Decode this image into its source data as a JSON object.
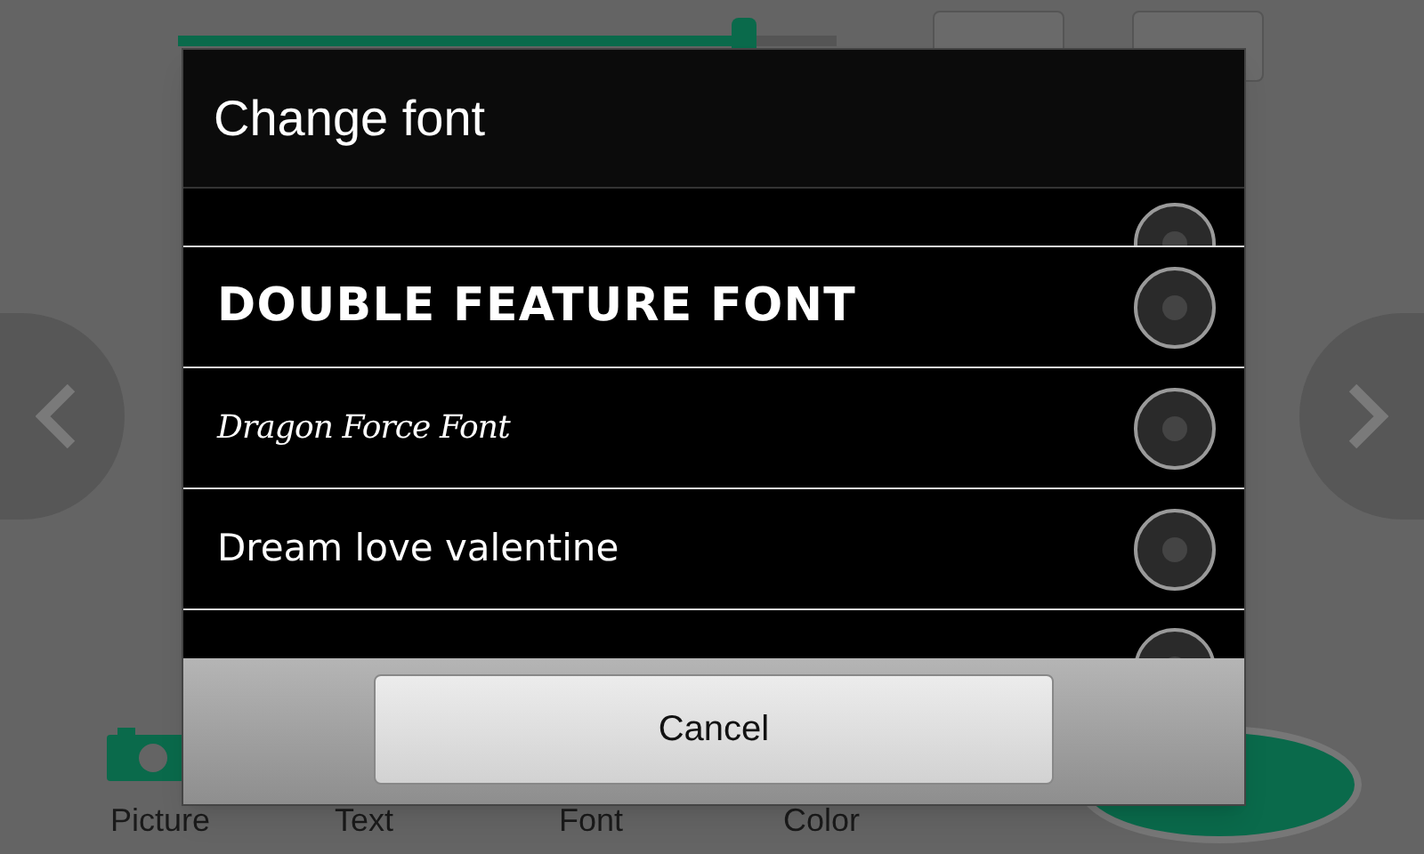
{
  "editor": {
    "slider": {
      "level": 0.86
    },
    "toolbar": [
      {
        "kind": "picture",
        "label": "Picture"
      },
      {
        "kind": "text",
        "label": "Text"
      },
      {
        "kind": "font",
        "label": "Font"
      },
      {
        "kind": "color",
        "label": "Color"
      }
    ]
  },
  "dialog": {
    "title": "Change font",
    "fonts": [
      {
        "kind": "partial-top",
        "selected": false
      },
      {
        "kind": "drip",
        "label": "DOUBLE FEATURE FONT",
        "selected": false
      },
      {
        "kind": "gothic",
        "label": "Dragon Force Font",
        "selected": false
      },
      {
        "kind": "script",
        "label": "Dream love valentine",
        "selected": false
      },
      {
        "kind": "partial-bottom",
        "selected": false
      }
    ],
    "cancel": "Cancel"
  }
}
